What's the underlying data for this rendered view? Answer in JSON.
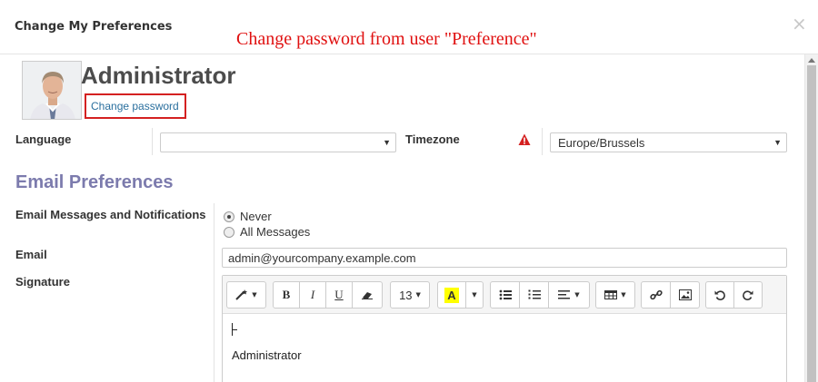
{
  "dialog": {
    "title": "Change My Preferences",
    "annotation": "Change password from user \"Preference\"",
    "close_icon": "×"
  },
  "user": {
    "name": "Administrator",
    "change_password_label": "Change password"
  },
  "form": {
    "language_label": "Language",
    "language_value": "",
    "timezone_label": "Timezone",
    "timezone_value": "Europe/Brussels",
    "email_prefs_title": "Email Preferences",
    "notifications_label": "Email Messages and Notifications",
    "notification_options": [
      "Never",
      "All Messages"
    ],
    "notification_selected": "Never",
    "email_label": "Email",
    "email_value": "admin@yourcompany.example.com",
    "signature_label": "Signature",
    "signature_text": "Administrator"
  },
  "toolbar": {
    "font_size": "13",
    "bold": "B",
    "italic": "I",
    "underline": "U",
    "highlight": "A"
  },
  "colors": {
    "annotation": "#e01010",
    "section_title": "#7c7bad",
    "link": "#2a6f9e",
    "warning": "#d42020",
    "highlight": "#ffff00"
  },
  "icons": {
    "warning": "warning-icon",
    "magic": "magic-wand-icon",
    "eraser": "eraser-icon",
    "list_ul": "unordered-list-icon",
    "list_ol": "ordered-list-icon",
    "align": "align-icon",
    "table": "table-icon",
    "link": "link-icon",
    "image": "image-icon",
    "undo": "undo-icon",
    "redo": "redo-icon"
  }
}
